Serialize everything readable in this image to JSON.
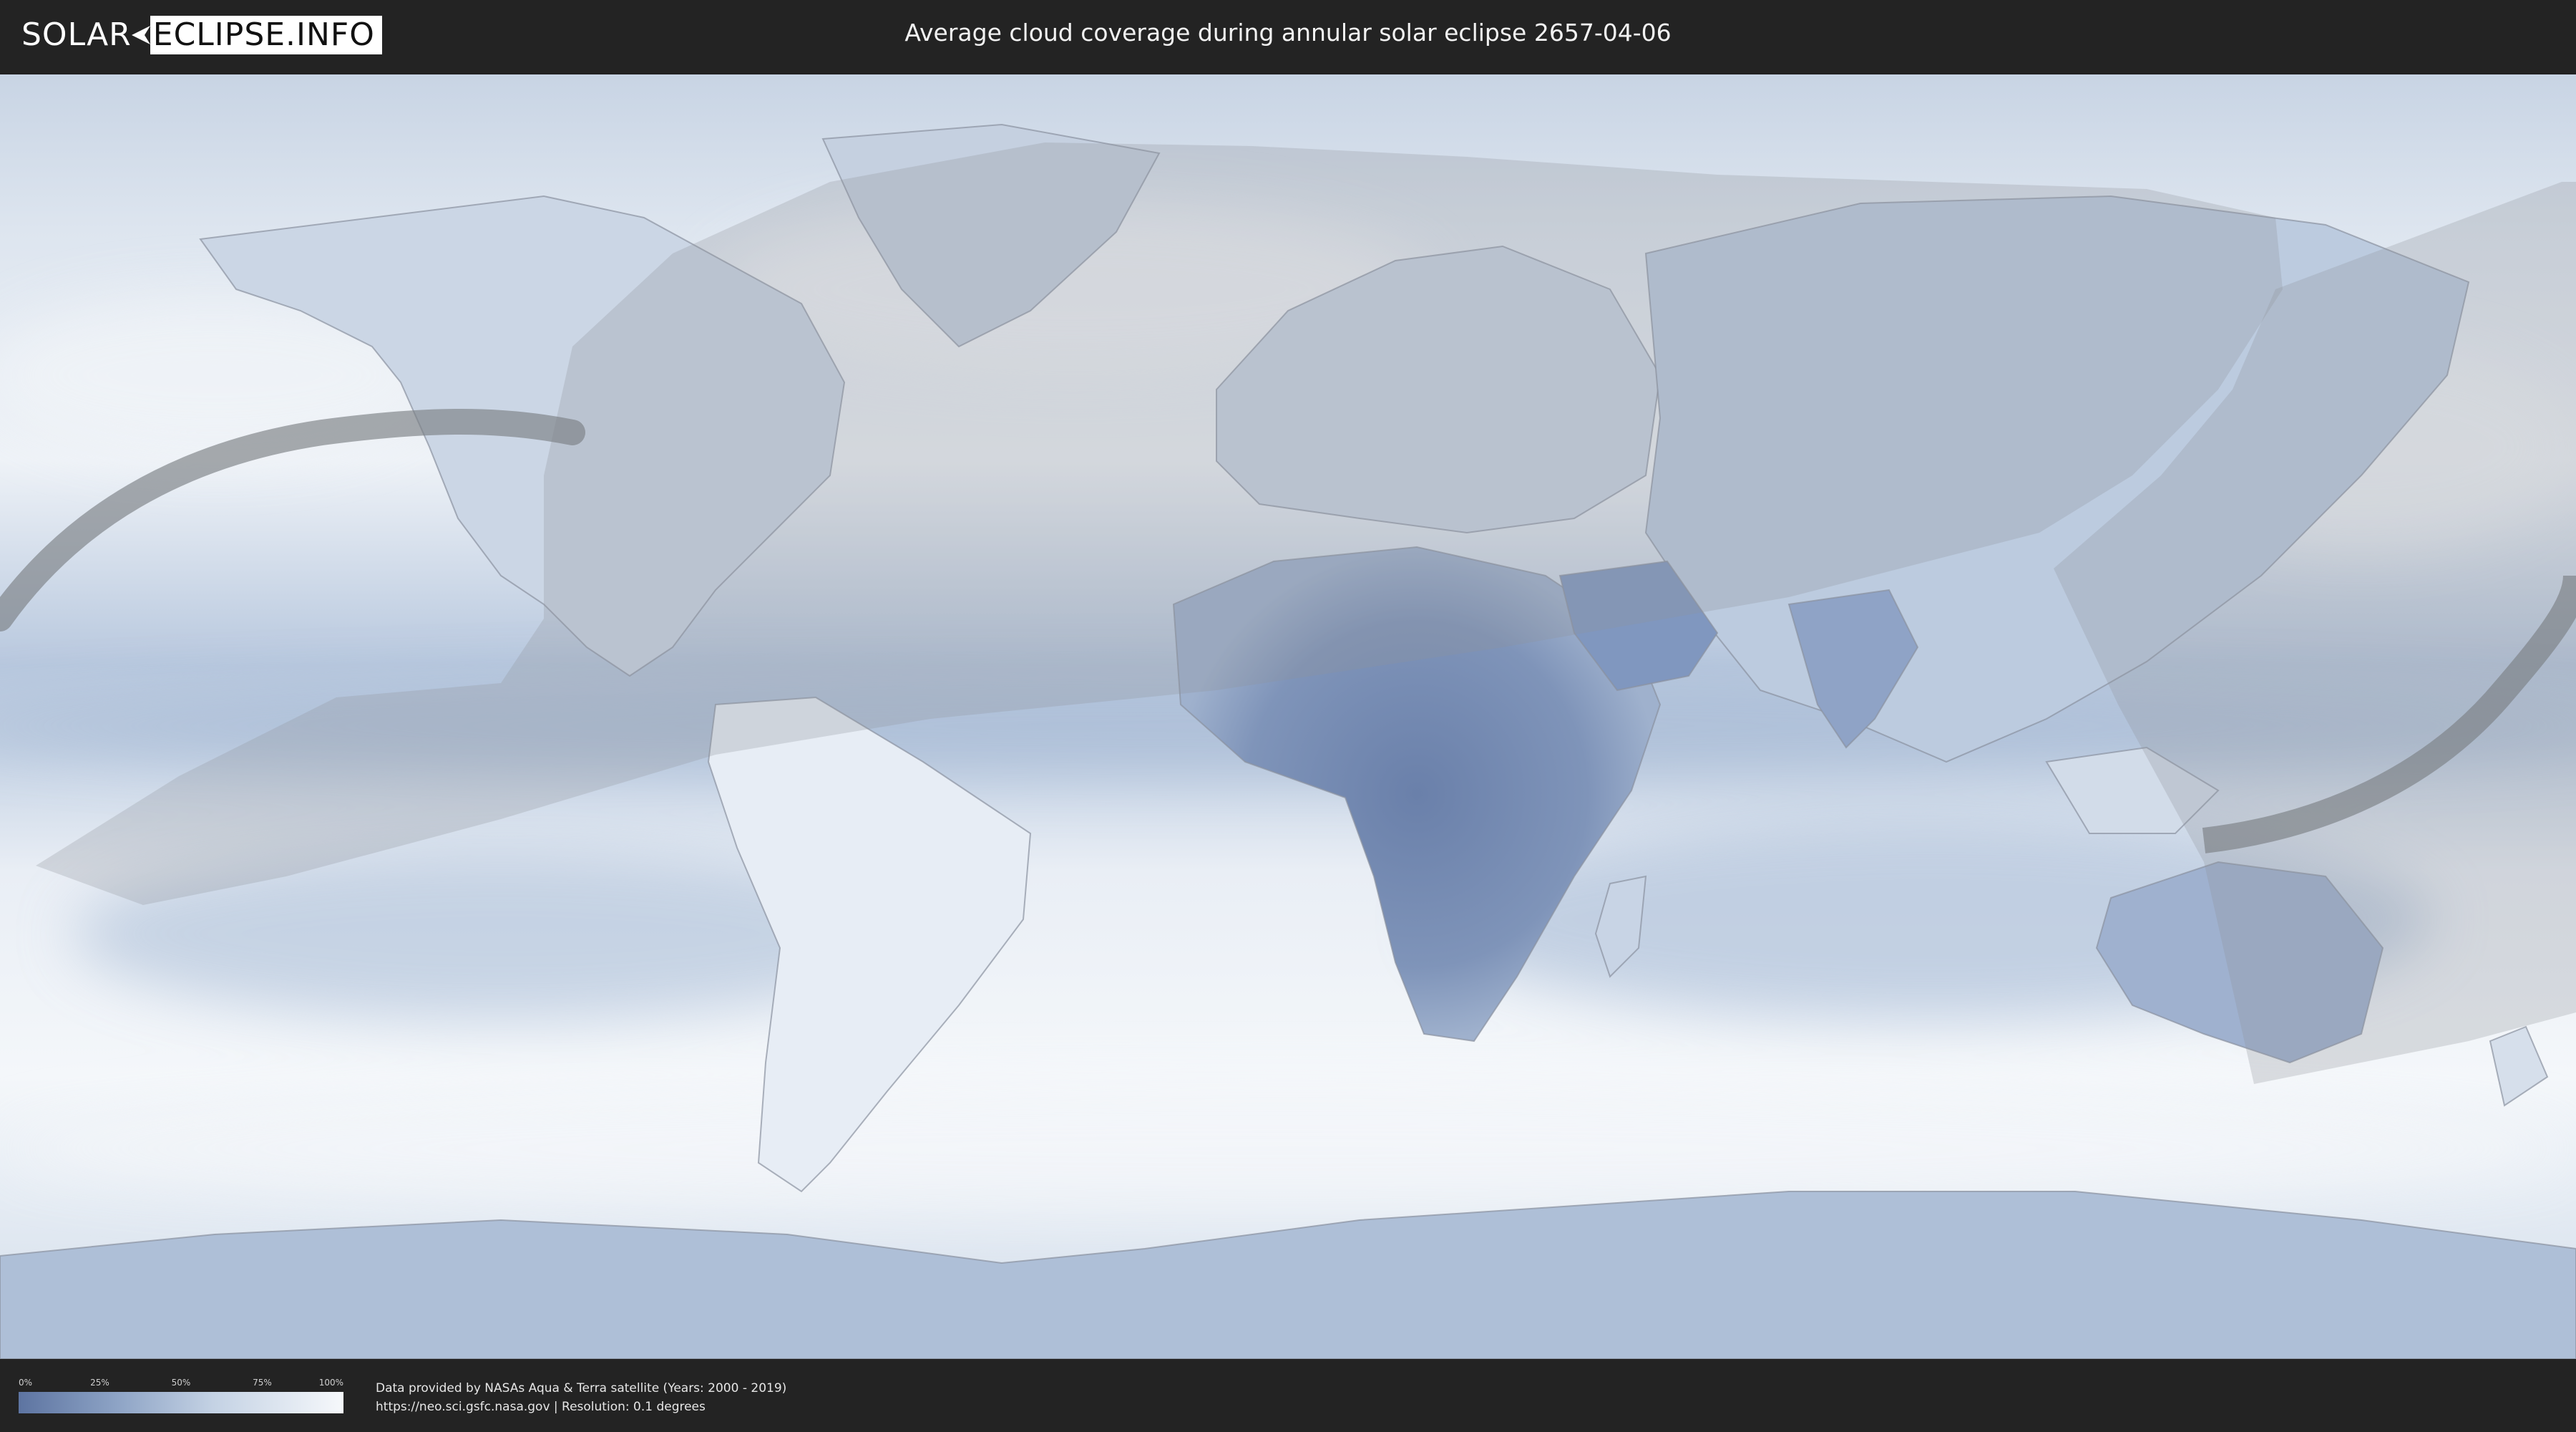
{
  "header": {
    "logo_left": "SOLAR",
    "logo_right": "ECLIPSE.INFO",
    "title": "Average cloud coverage during annular solar eclipse 2657-04-06"
  },
  "legend": {
    "ticks": [
      "0%",
      "25%",
      "50%",
      "75%",
      "100%"
    ],
    "colors": {
      "low": "#5d74a1",
      "high": "#f6f8fb"
    }
  },
  "footer": {
    "credit_line": "Data provided by NASAs Aqua & Terra satellite (Years: 2000 - 2019)",
    "source_line": "https://neo.sci.gsfc.nasa.gov | Resolution: 0.1 degrees"
  },
  "map": {
    "projection": "equirectangular",
    "colors": {
      "clear_sky": "#5d74a1",
      "overcast": "#f6f8fb",
      "eclipse_zone": "#9aa0a6",
      "annular_path": "#7b7f84",
      "borders": "#8a92a0"
    }
  }
}
